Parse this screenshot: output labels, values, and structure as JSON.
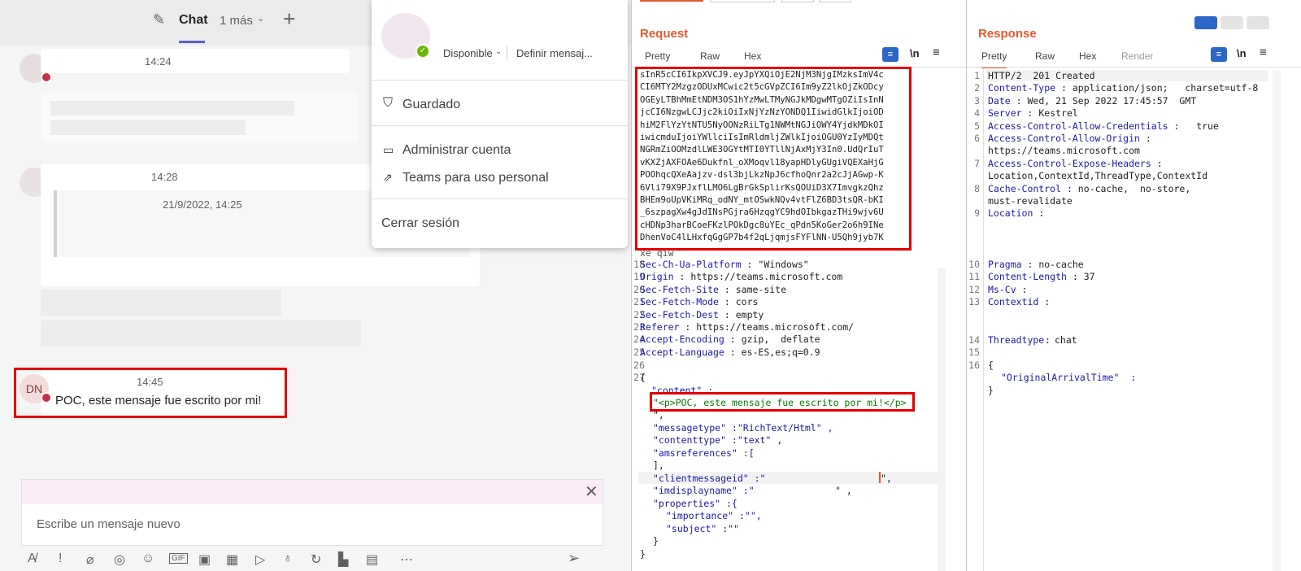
{
  "teams": {
    "header": {
      "chat_tab": "Chat",
      "more_tab": "1 más",
      "plus_label": "+"
    },
    "messages": [
      {
        "time": "14:24"
      },
      {
        "time": "14:28",
        "quoted_date": "21/9/2022, 14:25"
      },
      {
        "time": "14:45",
        "initials": "DN",
        "text": "POC, este mensaje fue escrito por mi!"
      }
    ],
    "profile_menu": {
      "status": "Disponible",
      "set_message": "Definir mensaj...",
      "saved": "Guardado",
      "manage_account": "Administrar cuenta",
      "personal": "Teams para uso personal",
      "sign_out": "Cerrar sesión"
    },
    "compose": {
      "placeholder": "Escribe un mensaje nuevo"
    }
  },
  "burp": {
    "request": {
      "title": "Request",
      "tabs": [
        "Pretty",
        "Raw",
        "Hex"
      ],
      "newline_label": "\\n",
      "token_lines": [
        "sInR5cCI6IkpXVCJ9.eyJpYXQiOjE2NjM3NjgIMzksImV4c",
        "CI6MTY2MzgzODUxMCwic2t5cGVpZCI6Im9yZ2lkOjZkODcy",
        "OGEyLTBhMmEtNDM3OS1hYzMwLTMyNGJkMDgwMTgOZiIsInN",
        "jcCI6NzgwLCJjc2kiOiIxNjYzNzYONDQ1IiwidGlkIjoiOD",
        "hiM2FlYzYtNTU5NyOONzRiLTg1NWMtNGJiOWY4YjdkMDkOI",
        "iwicmduIjoiYWllciIsImRldmljZWlkIjoiOGU0YzIyMDQt",
        "NGRmZiOOMzdlLWE3OGYtMTI0YTllNjAxMjY3In0.UdQrIuT",
        "vKXZjAXFOAe6Dukfnl_oXMoqvl18yapHDlyGUgiVQEXaHjG",
        "POOhqcQXeAajzv-dsl3bjLkzNpJ6cfhoQnr2a2cJjAGwp-K",
        "6Vli79X9PJxflLMO6LgBrGkSplirKsQOUiD3X7ImvgkzQhz",
        "BHEm9oUpVKiMRq_odNY_mtOSwkNQv4vtFlZ6BD3tsQR-bKI",
        "_6szpagXw4gJdINsPGjra6HzqgYC9hdOIbkgazTHi9wjv6U",
        "cHDNp3harBCoeFKzlPOkDgc8uYEc_qPdn5KoGer2o6h9INe",
        "DhenVoC4lLHxfqGgGP7b4f2qLjqmjsFYFlNN-U5Qh9jyb7K"
      ],
      "token_tail": "xe qiw",
      "header_lines": [
        {
          "n": "18",
          "k": "Sec-Ch-Ua-Platform",
          "v": "\"Windows\""
        },
        {
          "n": "19",
          "k": "Origin",
          "v": "https://teams.microsoft.com"
        },
        {
          "n": "20",
          "k": "Sec-Fetch-Site",
          "v": "same-site"
        },
        {
          "n": "21",
          "k": "Sec-Fetch-Mode",
          "v": "cors"
        },
        {
          "n": "22",
          "k": "Sec-Fetch-Dest",
          "v": "empty"
        },
        {
          "n": "23",
          "k": "Referer",
          "v": "https://teams.microsoft.com/"
        },
        {
          "n": "24",
          "k": "Accept-Encoding",
          "v": "gzip,  deflate"
        },
        {
          "n": "25",
          "k": "Accept-Language",
          "v": "es-ES,es;q=0.9"
        }
      ],
      "ln26": "26",
      "ln27": "27",
      "body": {
        "open": "{",
        "content_key": "\"content\" :",
        "content_val": "\"<p>POC, este mensaje fue escrito por mi!</p>",
        "content_close": "\",",
        "messagetype": "\"messagetype\" :\"RichText/Html\" ,",
        "contenttype": "\"contenttype\" :\"text\" ,",
        "amsreferences": "\"amsreferences\" :[",
        "amsclose": "],",
        "clientmessageid": "\"clientmessageid\" :\"",
        "clientmessageid_end": "\",",
        "imdisplayname": "\"imdisplayname\" :\"",
        "imdisplayname_end": "\" ,",
        "properties": "\"properties\" :{",
        "importance": "\"importance\" :\"\",",
        "subject": "\"subject\" :\"\"",
        "props_close": "}",
        "close": "}"
      }
    },
    "response": {
      "title": "Response",
      "tabs": [
        "Pretty",
        "Raw",
        "Hex",
        "Render"
      ],
      "newline_label": "\\n",
      "lines": [
        {
          "n": "1",
          "k": "",
          "v": "HTTP/2  201 Created"
        },
        {
          "n": "2",
          "k": "Content-Type",
          "v": "application/json;   charset=utf-8"
        },
        {
          "n": "3",
          "k": "Date",
          "v": "Wed, 21 Sep 2022 17:45:57  GMT"
        },
        {
          "n": "4",
          "k": "Server",
          "v": "Kestrel"
        },
        {
          "n": "5",
          "k": "Access-Control-Allow-Credentials",
          "v": "  true"
        },
        {
          "n": "6",
          "k": "Access-Control-Allow-Origin",
          "v": ""
        },
        {
          "n": "",
          "k": "",
          "v": "https://teams.microsoft.com"
        },
        {
          "n": "7",
          "k": "Access-Control-Expose-Headers",
          "v": ""
        },
        {
          "n": "",
          "k": "",
          "v": "Location,ContextId,ThreadType,ContextId"
        },
        {
          "n": "8",
          "k": "Cache-Control",
          "v": "no-cache,  no-store,"
        },
        {
          "n": "",
          "k": "",
          "v": "must-revalidate"
        },
        {
          "n": "9",
          "k": "Location",
          "v": ""
        }
      ],
      "lines2": [
        {
          "n": "10",
          "k": "Pragma",
          "v": "no-cache"
        },
        {
          "n": "11",
          "k": "Content-Length",
          "v": "37"
        },
        {
          "n": "12",
          "k": "Ms-Cv",
          "v": ""
        },
        {
          "n": "13",
          "k": "Contextid",
          "v": ""
        }
      ],
      "ln14": "14",
      "threadtype_k": "Threadtype",
      "threadtype_v": "chat",
      "ln15": "15",
      "ln16": "16",
      "json_open": "{",
      "json_key": "\"OriginalArrivalTime\"  :",
      "json_close": "}"
    }
  }
}
